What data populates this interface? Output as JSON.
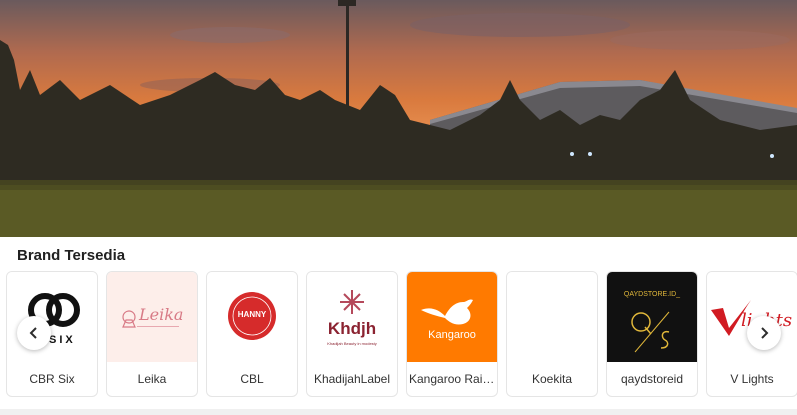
{
  "hero": {
    "icon": "sunset-photo"
  },
  "brands": {
    "title": "Brand Tersedia",
    "items": [
      {
        "name": "CBR Six",
        "logo_text": "SIX",
        "bg": "#ffffff"
      },
      {
        "name": "Leika",
        "logo_text": "Leika",
        "bg": "#fdeeea"
      },
      {
        "name": "CBL",
        "logo_text": "HANNY",
        "bg": "#ffffff"
      },
      {
        "name": "KhadijahLabel",
        "logo_text": "Khdjh",
        "logo_subtext": "Khadijah Beauty in modesty",
        "bg": "#ffffff"
      },
      {
        "name": "Kangaroo Rain...",
        "logo_text": "Kangaroo",
        "bg": "#ff7a00"
      },
      {
        "name": "Koekita",
        "logo_text": "",
        "bg": "#ffffff"
      },
      {
        "name": "qaydstoreid",
        "logo_text": "QAYDSTORE.ID_",
        "bg": "#111111"
      },
      {
        "name": "V Lights",
        "logo_text": "lights",
        "bg": "#ffffff"
      }
    ],
    "prev_icon": "chevron-left-icon",
    "next_icon": "chevron-right-icon"
  }
}
